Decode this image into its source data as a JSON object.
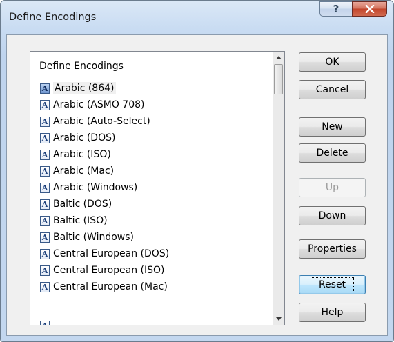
{
  "window": {
    "title": "Define Encodings",
    "help_glyph": "?",
    "close_icon": "close-x-icon"
  },
  "list": {
    "header": "Define Encodings",
    "item_icon": "encoding-icon",
    "icon_glyph": "A",
    "selected_index": 0,
    "items": [
      "Arabic (864)",
      "Arabic (ASMO 708)",
      "Arabic (Auto-Select)",
      "Arabic (DOS)",
      "Arabic (ISO)",
      "Arabic (Mac)",
      "Arabic (Windows)",
      "Baltic (DOS)",
      "Baltic (ISO)",
      "Baltic (Windows)",
      "Central European (DOS)",
      "Central European (ISO)",
      "Central European (Mac)"
    ]
  },
  "buttons": {
    "ok": "OK",
    "cancel": "Cancel",
    "new": "New",
    "delete": "Delete",
    "up": "Up",
    "down": "Down",
    "properties": "Properties",
    "reset": "Reset",
    "help": "Help"
  },
  "colors": {
    "close_red": "#c2452c",
    "frame_blue": "#c3d7ef",
    "default_button_border": "#3c7fb1"
  }
}
